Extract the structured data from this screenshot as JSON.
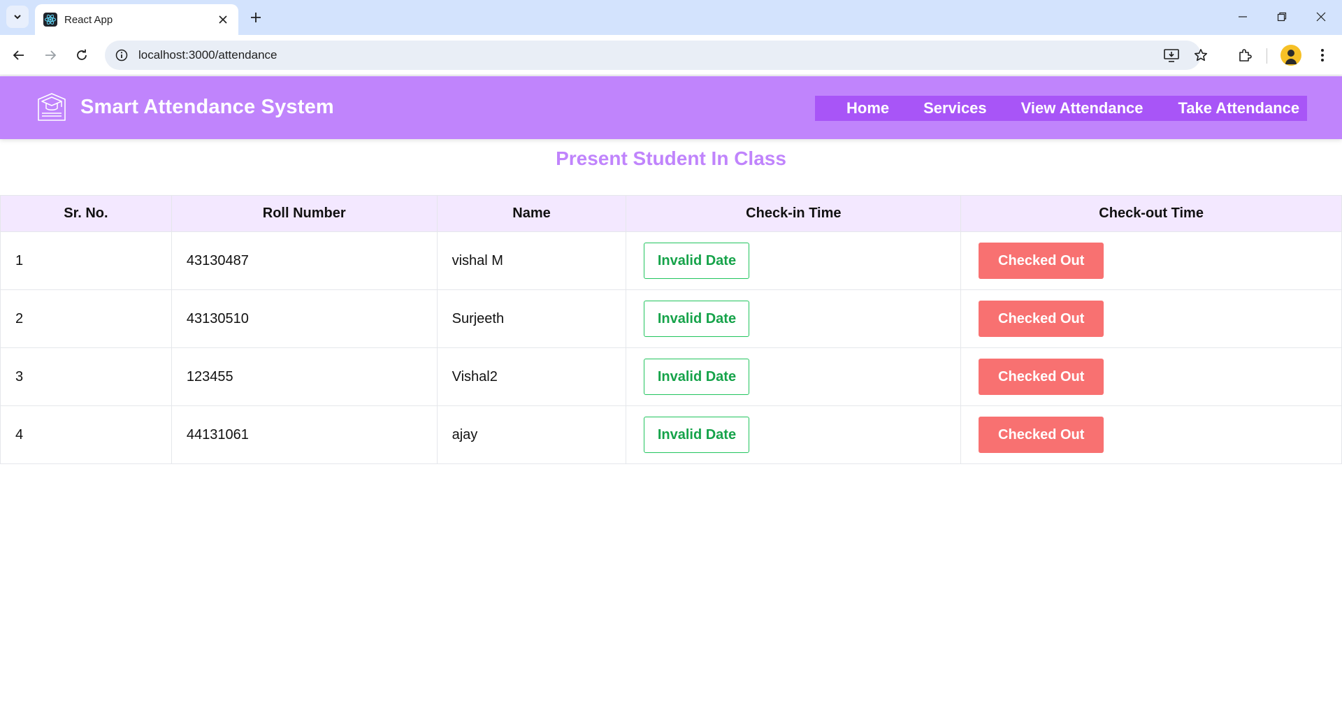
{
  "browser": {
    "tab_title": "React App",
    "url": "localhost:3000/attendance"
  },
  "header": {
    "title": "Smart Attendance System",
    "nav": [
      {
        "label": "Home"
      },
      {
        "label": "Services"
      },
      {
        "label": "View Attendance"
      },
      {
        "label": "Take Attendance"
      }
    ]
  },
  "page": {
    "heading": "Present Student In Class"
  },
  "table": {
    "columns": [
      "Sr. No.",
      "Roll Number",
      "Name",
      "Check-in Time",
      "Check-out Time"
    ],
    "rows": [
      {
        "sr": "1",
        "roll": "43130487",
        "name": "vishal M",
        "checkin": "Invalid Date",
        "checkout": "Checked Out"
      },
      {
        "sr": "2",
        "roll": "43130510",
        "name": "Surjeeth",
        "checkin": "Invalid Date",
        "checkout": "Checked Out"
      },
      {
        "sr": "3",
        "roll": "123455",
        "name": "Vishal2",
        "checkin": "Invalid Date",
        "checkout": "Checked Out"
      },
      {
        "sr": "4",
        "roll": "44131061",
        "name": "ajay",
        "checkin": "Invalid Date",
        "checkout": "Checked Out"
      }
    ]
  },
  "colors": {
    "header_bg": "#c084fc",
    "nav_bg": "#a855f7",
    "table_head_bg": "#f3e8ff",
    "checkin_green": "#16a34a",
    "checkout_red": "#f87171"
  },
  "icons": [
    "tab-search-icon",
    "react-favicon-icon",
    "close-icon",
    "plus-icon",
    "minimize-icon",
    "restore-icon",
    "window-close-icon",
    "back-icon",
    "forward-icon",
    "reload-icon",
    "site-info-icon",
    "install-app-icon",
    "bookmark-star-icon",
    "extensions-icon",
    "profile-avatar",
    "more-menu-icon",
    "graduation-cap-icon"
  ]
}
